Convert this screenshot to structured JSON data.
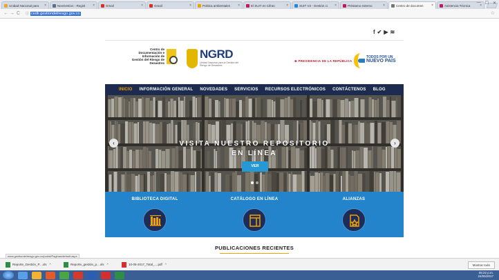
{
  "browser": {
    "tabs": [
      {
        "title": "Unidad Nacional para",
        "color": "#e5a82a",
        "active": false
      },
      {
        "title": "NexGestion - Regist",
        "color": "#5b6e8a",
        "active": false
      },
      {
        "title": "Gmail",
        "color": "#d93025",
        "active": false
      },
      {
        "title": "Gmail",
        "color": "#d93025",
        "active": false
      },
      {
        "title": "Politica ambientales",
        "color": "#f2a200",
        "active": false
      },
      {
        "title": "El SUIT en Cifras",
        "color": "#c2185b",
        "active": false
      },
      {
        "title": "SUIT V3 - Gestión ci",
        "color": "#1e88e5",
        "active": false
      },
      {
        "title": "Préstamo externo",
        "color": "#c2185b",
        "active": false
      },
      {
        "title": "Centro de documen",
        "color": "#777777",
        "active": true
      },
      {
        "title": "Asistencia Técnica",
        "color": "#c2185b",
        "active": false
      }
    ],
    "url": "cedir.gestiondelriesgo.gov.co"
  },
  "social_icons": [
    "facebook-icon",
    "twitter-icon",
    "youtube-icon",
    "rss-icon"
  ],
  "social_glyphs": [
    "f",
    "✔",
    "▶",
    "≋"
  ],
  "header": {
    "cdoc_text": "Centro de Documentación e Información de Gestión del Riesgo de Desastres",
    "ngrd_logo": "NGRD",
    "ngrd_sub": "Unidad Nacional para la Gestión del Riesgo de Desastres",
    "presidencia": "PRESIDENCIA DE LA REPÚBLICA",
    "todos_line1": "TODOS POR UN",
    "todos_line2": "NUEVO PAÍS"
  },
  "nav": {
    "items": [
      "INICIO",
      "INFORMACIÓN GENERAL",
      "NOVEDADES",
      "SERVICIOS",
      "RECURSOS ELECTRÓNICOS",
      "CONTÁCTENOS",
      "BLOG"
    ],
    "active_index": 0
  },
  "hero": {
    "title_line1": "VISITA NUESTRO REPOSITORIO",
    "title_line2": "EN LÍNEA",
    "button": "VER",
    "slide_count": 2,
    "active_slide": 0
  },
  "services": [
    {
      "label": "BIBLIOTECA DIGITAL",
      "icon": "library-icon"
    },
    {
      "label": "CATÁLOGO EN LÍNEA",
      "icon": "catalog-icon"
    },
    {
      "label": "ALIANZAS",
      "icon": "alliance-icon"
    }
  ],
  "publications_heading": "PUBLICACIONES RECIENTES",
  "status_url": "www.gestiondelriesgo.gov.co/portal/Paginas/default.aspx",
  "downloads": [
    {
      "name": "Reporte_Gestión_P....xls",
      "type": "excel"
    },
    {
      "name": "Reporte_gestión_p....xls",
      "type": "excel"
    },
    {
      "name": "10-05-2017_Total_....pdf",
      "type": "pdf"
    }
  ],
  "show_all": "Mostrar todo",
  "taskbar": {
    "apps": [
      "#5aa0e8",
      "#f2b233",
      "#e25b2a",
      "#4aa547",
      "#d33a2c",
      "#2b5fb4",
      "#d32f2f",
      "#2f8d45"
    ],
    "clock_time": "05:22 p.m.",
    "clock_date": "24/05/2017"
  }
}
